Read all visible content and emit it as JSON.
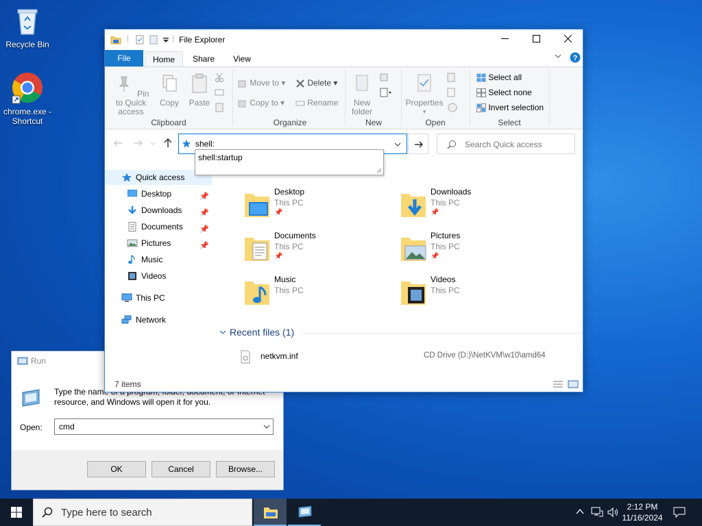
{
  "desktop": {
    "icons": [
      {
        "label": "Recycle Bin",
        "icon": "recycle-bin-icon"
      },
      {
        "label": "chrome.exe - Shortcut",
        "icon": "chrome-icon"
      }
    ]
  },
  "explorer": {
    "title": "File Explorer",
    "tabs": [
      "File",
      "Home",
      "Share",
      "View"
    ],
    "ribbon": {
      "clipboard": {
        "label": "Clipboard",
        "pin": "Pin to Quick access",
        "copy": "Copy",
        "paste": "Paste"
      },
      "organize": {
        "label": "Organize",
        "move_to": "Move to",
        "copy_to": "Copy to",
        "delete": "Delete",
        "rename": "Rename"
      },
      "new": {
        "label": "New",
        "new_folder": "New folder"
      },
      "open": {
        "label": "Open",
        "properties": "Properties"
      },
      "select": {
        "label": "Select",
        "select_all": "Select all",
        "select_none": "Select none",
        "invert": "Invert selection"
      }
    },
    "address": {
      "value": "shell:",
      "suggestion": "shell:startup"
    },
    "search": {
      "placeholder": "Search Quick access"
    },
    "nav": {
      "quick_access": "Quick access",
      "items": [
        "Desktop",
        "Downloads",
        "Documents",
        "Pictures",
        "Music",
        "Videos"
      ],
      "this_pc": "This PC",
      "network": "Network"
    },
    "folders": [
      {
        "name": "Desktop",
        "location": "This PC"
      },
      {
        "name": "Downloads",
        "location": "This PC"
      },
      {
        "name": "Documents",
        "location": "This PC"
      },
      {
        "name": "Pictures",
        "location": "This PC"
      },
      {
        "name": "Music",
        "location": "This PC"
      },
      {
        "name": "Videos",
        "location": "This PC"
      }
    ],
    "recent": {
      "header": "Recent files (1)",
      "files": [
        {
          "name": "netkvm.inf",
          "path": "CD Drive (D:)\\NetKVM\\w10\\amd64"
        }
      ]
    },
    "status": "7 items"
  },
  "run": {
    "title": "Run",
    "description": "Type the name of a program, folder, document, or Internet resource, and Windows will open it for you.",
    "open_label": "Open:",
    "open_value": "cmd",
    "ok": "OK",
    "cancel": "Cancel",
    "browse": "Browse..."
  },
  "taskbar": {
    "search_placeholder": "Type here to search",
    "time": "2:12 PM",
    "date": "11/16/2024"
  }
}
